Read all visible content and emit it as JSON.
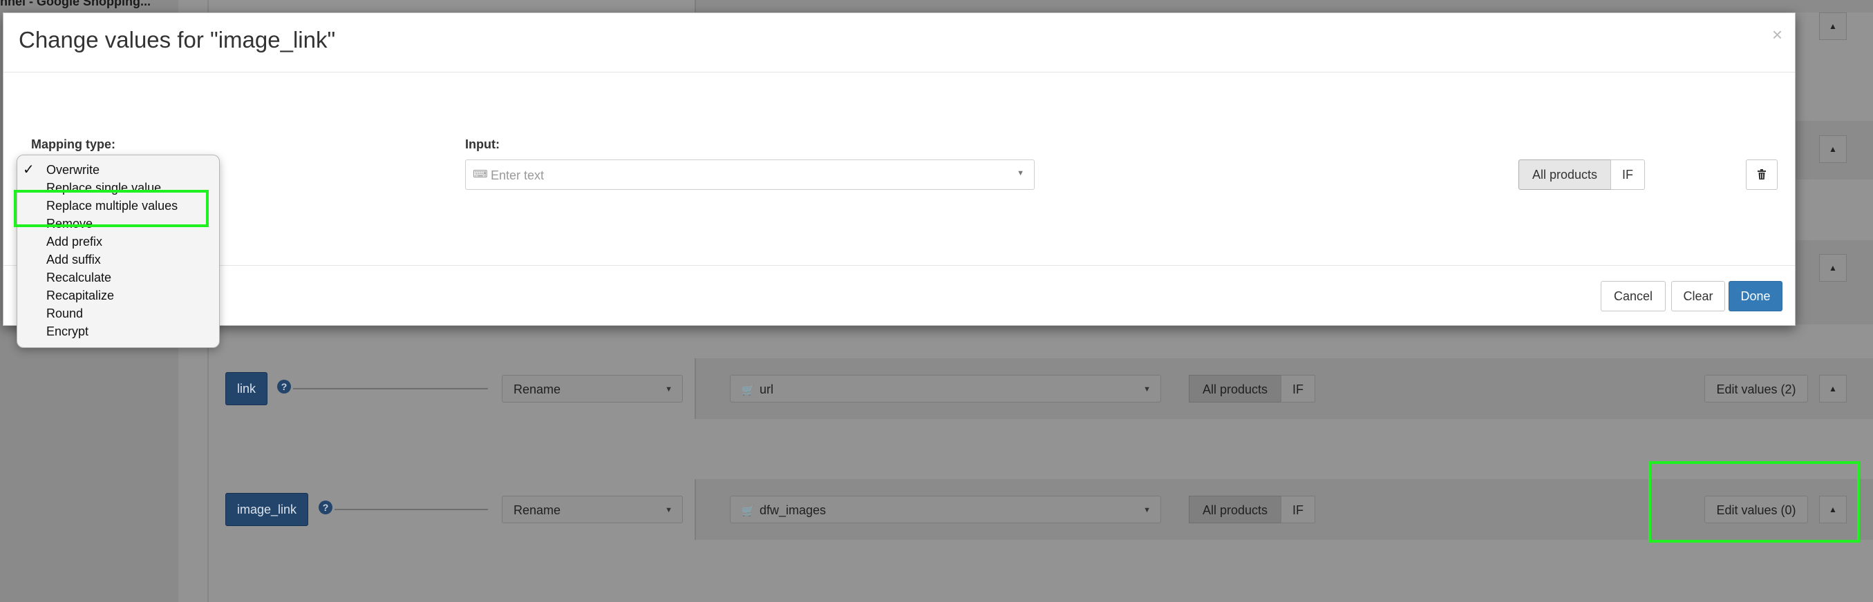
{
  "background": {
    "breadcrumb": "nnel - Google Shopping...",
    "rows": [
      {
        "field": "link",
        "mode": "Rename",
        "source": "url",
        "scope_all": "All products",
        "scope_if": "IF",
        "edit_values": "Edit values (2)"
      },
      {
        "field": "image_link",
        "mode": "Rename",
        "source": "dfw_images",
        "scope_all": "All products",
        "scope_if": "IF",
        "edit_values": "Edit values (0)"
      }
    ]
  },
  "modal": {
    "title": "Change values for \"image_link\"",
    "close": "×",
    "mapping_type_label": "Mapping type:",
    "input_label": "Input:",
    "input_placeholder": "Enter text",
    "input_value": "",
    "scope_all": "All products",
    "scope_if": "IF",
    "footer": {
      "cancel": "Cancel",
      "clear": "Clear",
      "done": "Done"
    }
  },
  "mapping_dropdown": {
    "selected": "Overwrite",
    "options": [
      "Overwrite",
      "Replace single value",
      "Replace multiple values",
      "Remove",
      "Add prefix",
      "Add suffix",
      "Recalculate",
      "Recapitalize",
      "Round",
      "Encrypt"
    ]
  },
  "colors": {
    "highlight": "#1ff01f",
    "primary": "#337ab7",
    "field_tag": "#23456c"
  }
}
